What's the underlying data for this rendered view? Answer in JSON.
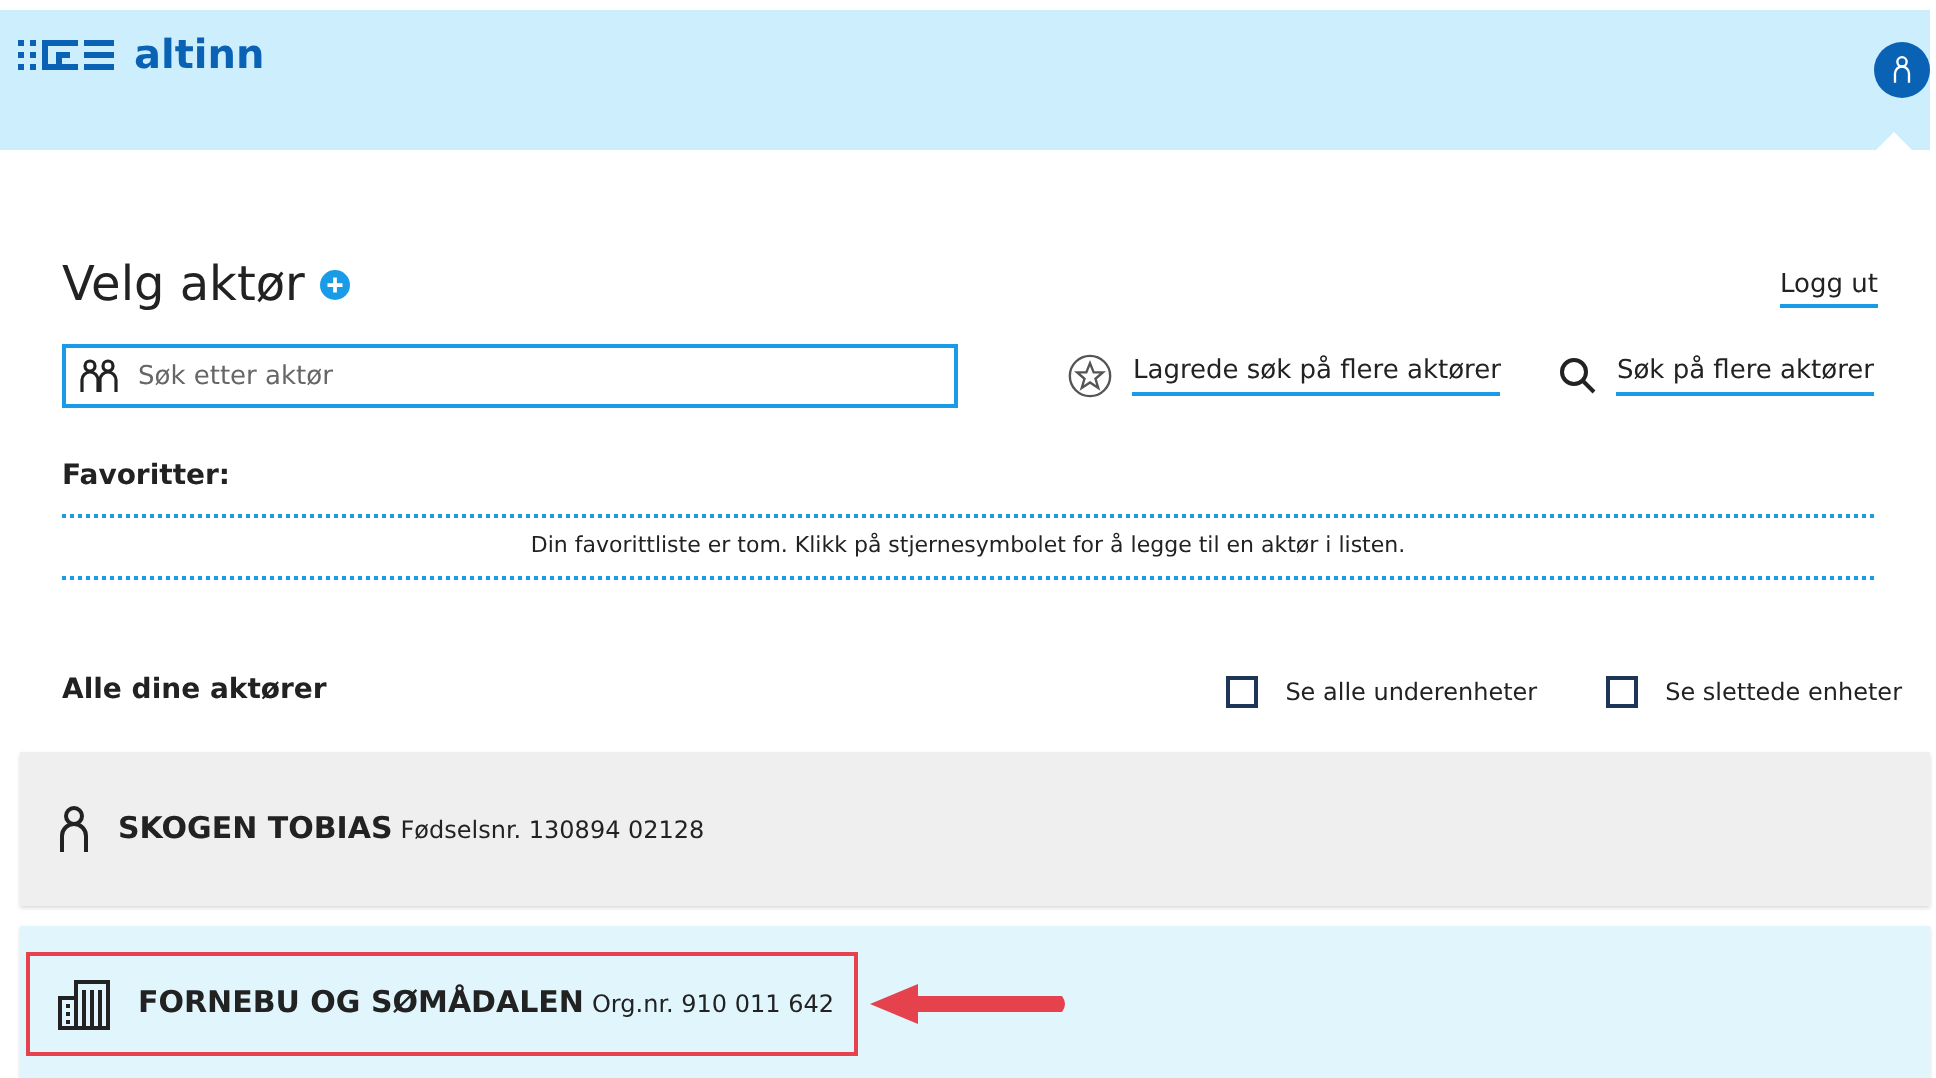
{
  "header": {
    "logo_text": "altinn"
  },
  "title": "Velg aktør",
  "logout": "Logg ut",
  "search": {
    "placeholder": "Søk etter aktør"
  },
  "links": [
    {
      "kind": "star",
      "label": "Lagrede søk på flere aktører"
    },
    {
      "kind": "search",
      "label": "Søk på flere aktører"
    }
  ],
  "favorites": {
    "heading": "Favoritter:",
    "empty_text": "Din favorittliste er tom. Klikk på stjernesymbolet for å legge til en aktør i listen."
  },
  "all_actors": {
    "heading": "Alle dine aktører",
    "filters": [
      {
        "label": "Se alle underenheter",
        "checked": false
      },
      {
        "label": "Se slettede enheter",
        "checked": false
      }
    ]
  },
  "actors": [
    {
      "kind": "person",
      "name": "SKOGEN TOBIAS",
      "id_text": "Fødselsnr. 130894 02128",
      "selected": false,
      "annotated": false
    },
    {
      "kind": "organization",
      "name": "FORNEBU OG SØMÅDALEN",
      "id_text": "Org.nr. 910 011 642",
      "selected": true,
      "annotated": true
    }
  ]
}
